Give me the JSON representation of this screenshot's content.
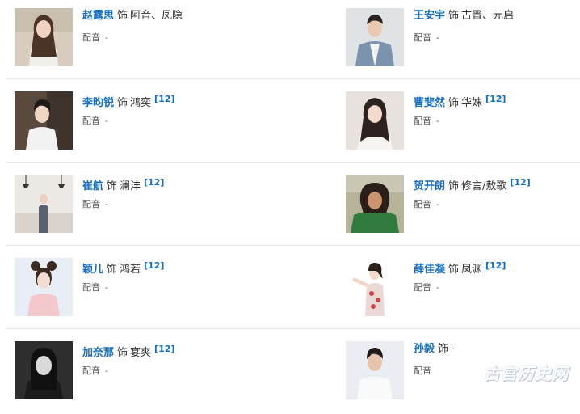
{
  "cast": [
    {
      "actor": "赵露思",
      "shi": "饰",
      "role": "阿音、凤隐",
      "ref": "",
      "dub_label": "配音",
      "dub_value": "-"
    },
    {
      "actor": "王安宇",
      "shi": "饰",
      "role": "古晋、元启",
      "ref": "",
      "dub_label": "配音",
      "dub_value": "-"
    },
    {
      "actor": "李昀锐",
      "shi": "饰",
      "role": "鸿奕",
      "ref": "[12]",
      "dub_label": "配音",
      "dub_value": "-"
    },
    {
      "actor": "曹斐然",
      "shi": "饰",
      "role": "华姝",
      "ref": "[12]",
      "dub_label": "配音",
      "dub_value": "-"
    },
    {
      "actor": "崔航",
      "shi": "饰",
      "role": "澜沣",
      "ref": "[12]",
      "dub_label": "配音",
      "dub_value": "-"
    },
    {
      "actor": "贺开朗",
      "shi": "饰",
      "role": "修言/敖歌",
      "ref": "[12]",
      "dub_label": "配音",
      "dub_value": "-"
    },
    {
      "actor": "颖儿",
      "shi": "饰",
      "role": "鸿若",
      "ref": "[12]",
      "dub_label": "配音",
      "dub_value": "-"
    },
    {
      "actor": "薛佳凝",
      "shi": "饰",
      "role": "凤渊",
      "ref": "[12]",
      "dub_label": "配音",
      "dub_value": "-"
    },
    {
      "actor": "加奈那",
      "shi": "饰",
      "role": "宴爽",
      "ref": "[12]",
      "dub_label": "配音",
      "dub_value": "-"
    },
    {
      "actor": "孙毅",
      "shi": "饰",
      "role": "-",
      "ref": "",
      "dub_label": "配音",
      "dub_value": ""
    }
  ],
  "watermark": "古宫历史网"
}
